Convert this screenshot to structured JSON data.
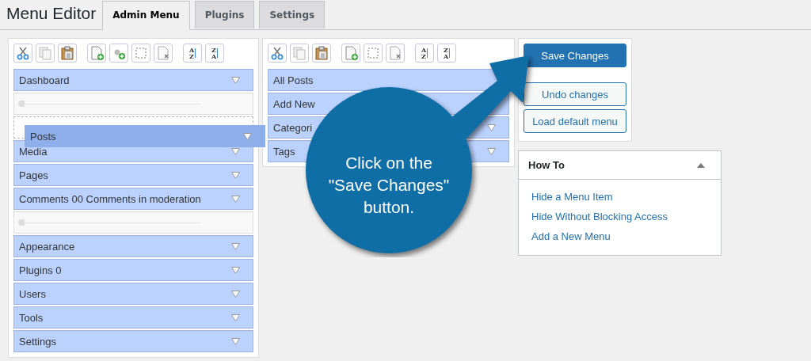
{
  "header": {
    "title": "Menu Editor"
  },
  "tabs": [
    {
      "label": "Admin Menu",
      "selected": true
    },
    {
      "label": "Plugins",
      "selected": false
    },
    {
      "label": "Settings",
      "selected": false
    }
  ],
  "left_panel": {
    "toolbar": [
      {
        "kind": "cut"
      },
      {
        "kind": "copy"
      },
      {
        "kind": "paste"
      },
      {
        "kind": "new"
      },
      {
        "kind": "new_separator"
      },
      {
        "kind": "select"
      },
      {
        "kind": "delete"
      },
      {
        "kind": "sort",
        "glyphs": [
          "A",
          "Z"
        ]
      },
      {
        "kind": "sort",
        "glyphs": [
          "Z",
          "A"
        ]
      }
    ],
    "items": [
      {
        "kind": "item",
        "label": "Dashboard",
        "dropdown": true
      },
      {
        "kind": "separator"
      },
      {
        "kind": "drop_target"
      },
      {
        "kind": "item",
        "label": "Media",
        "dropdown": true
      },
      {
        "kind": "item",
        "label": "Pages",
        "dropdown": true
      },
      {
        "kind": "item",
        "label": "Comments 00 Comments in moderation",
        "dropdown": true
      },
      {
        "kind": "separator"
      },
      {
        "kind": "item",
        "label": "Appearance",
        "dropdown": true
      },
      {
        "kind": "item",
        "label": "Plugins 0",
        "dropdown": true
      },
      {
        "kind": "item",
        "label": "Users",
        "dropdown": true
      },
      {
        "kind": "item",
        "label": "Tools",
        "dropdown": true
      },
      {
        "kind": "item",
        "label": "Settings",
        "dropdown": true
      }
    ]
  },
  "dragged_item": {
    "label": "Posts"
  },
  "middle_panel": {
    "toolbar": [
      {
        "kind": "cut"
      },
      {
        "kind": "copy"
      },
      {
        "kind": "paste"
      },
      {
        "kind": "new"
      },
      {
        "kind": "select"
      },
      {
        "kind": "delete"
      },
      {
        "kind": "sort",
        "glyphs": [
          "A",
          "Z"
        ]
      },
      {
        "kind": "sort",
        "glyphs": [
          "Z",
          "A"
        ]
      }
    ],
    "items": [
      {
        "kind": "item",
        "label": "All Posts"
      },
      {
        "kind": "item",
        "label": "Add New"
      },
      {
        "kind": "item",
        "label": "Categori",
        "dropdown": true
      },
      {
        "kind": "item",
        "label": "Tags",
        "dropdown": true
      }
    ]
  },
  "actions": [
    {
      "kind": "primary",
      "label": "Save Changes"
    },
    {
      "kind": "secondary",
      "label": "Undo changes"
    },
    {
      "kind": "secondary",
      "label": "Load default menu"
    }
  ],
  "how_to": {
    "title": "How To",
    "expanded": true,
    "links": [
      "Hide a Menu Item",
      "Hide Without Blocking Access",
      "Add a New Menu"
    ]
  },
  "callout": {
    "lines": [
      "Click on the",
      "\"Save Changes\"",
      "button."
    ]
  }
}
